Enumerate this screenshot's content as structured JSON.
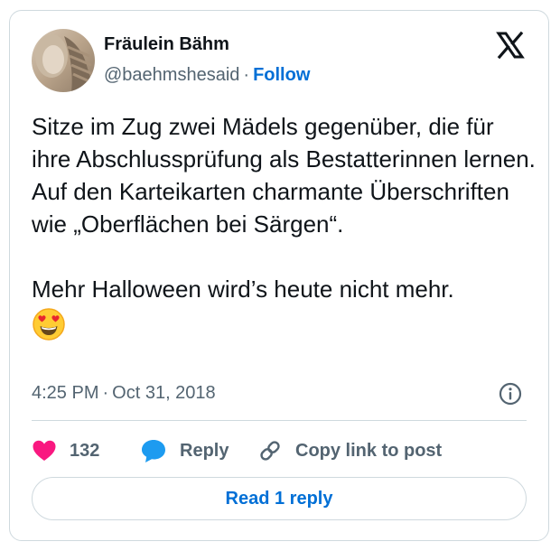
{
  "author": {
    "name": "Fräulein Bähm",
    "handle": "@baehmshesaid",
    "separator": "·",
    "follow_label": "Follow",
    "avatar": "profile-photo",
    "platform_icon": "x-logo-icon"
  },
  "tweet": {
    "paragraphs": [
      "Sitze im Zug zwei Mädels gegenüber, die für ihre Abschlussprüfung als Bestatterinnen lernen. Auf den Karteikarten charmante Überschriften wie „Oberflächen bei Särgen“.",
      "Mehr Halloween wird’s heute nicht mehr."
    ],
    "emoji": "heart-eyes-emoji"
  },
  "meta": {
    "time": "4:25 PM",
    "separator": "·",
    "date": "Oct 31, 2018",
    "info_icon": "info-icon"
  },
  "actions": {
    "like_count": "132",
    "reply_label": "Reply",
    "copy_link_label": "Copy link to post"
  },
  "read_reply_label": "Read 1 reply",
  "colors": {
    "accent": "#006fd6",
    "like": "#f91880",
    "reply": "#1d9bf0",
    "secondary_text": "#536471",
    "border": "#cfd9de"
  }
}
